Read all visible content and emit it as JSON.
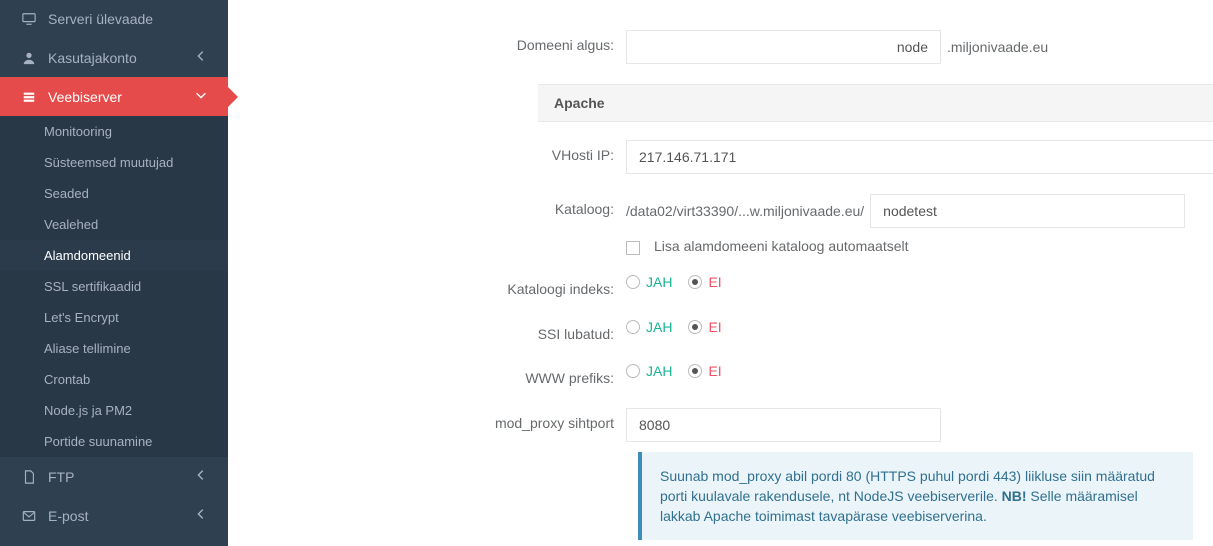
{
  "sidebar": {
    "items": [
      {
        "icon": "monitor",
        "label": "Serveri ülevaade",
        "expandable": false
      },
      {
        "icon": "user",
        "label": "Kasutajakonto",
        "expandable": true
      },
      {
        "icon": "layers",
        "label": "Veebiserver",
        "expandable": true,
        "active": true,
        "children": [
          {
            "label": "Monitooring"
          },
          {
            "label": "Süsteemsed muutujad"
          },
          {
            "label": "Seaded"
          },
          {
            "label": "Vealehed"
          },
          {
            "label": "Alamdomeenid",
            "active": true
          },
          {
            "label": "SSL sertifikaadid"
          },
          {
            "label": "Let's Encrypt"
          },
          {
            "label": "Aliase tellimine"
          },
          {
            "label": "Crontab"
          },
          {
            "label": "Node.js ja PM2"
          },
          {
            "label": "Portide suunamine"
          }
        ]
      },
      {
        "icon": "doc",
        "label": "FTP",
        "expandable": true
      },
      {
        "icon": "mail",
        "label": "E-post",
        "expandable": true
      }
    ]
  },
  "form": {
    "domain_start": {
      "label": "Domeeni algus:",
      "value": "node",
      "suffix": ".miljonivaade.eu"
    },
    "apache_header": "Apache",
    "vhost_ip": {
      "label": "VHosti IP:",
      "value": "217.146.71.171"
    },
    "catalog": {
      "label": "Kataloog:",
      "path": "/data02/virt33390/...w.miljonivaade.eu/",
      "value": "nodetest"
    },
    "auto_catalog": {
      "label": "Lisa alamdomeeni kataloog automaatselt",
      "checked": false
    },
    "catalog_index": {
      "label": "Kataloogi indeks:",
      "yes": "JAH",
      "no": "EI",
      "value": "no"
    },
    "ssi": {
      "label": "SSI lubatud:",
      "yes": "JAH",
      "no": "EI",
      "value": "no"
    },
    "www_prefix": {
      "label": "WWW prefiks:",
      "yes": "JAH",
      "no": "EI",
      "value": "no"
    },
    "mod_proxy": {
      "label": "mod_proxy sihtport",
      "value": "8080"
    },
    "info": {
      "text1": "Suunab mod_proxy abil pordi 80 (HTTPS puhul pordi 443) liikluse siin määratud porti kuulavale rakendusele, nt NodeJS veebiserverile. ",
      "nb": "NB!",
      "text2": " Selle määramisel lakkab Apache toimimast tavapärase veebiserverina."
    }
  }
}
